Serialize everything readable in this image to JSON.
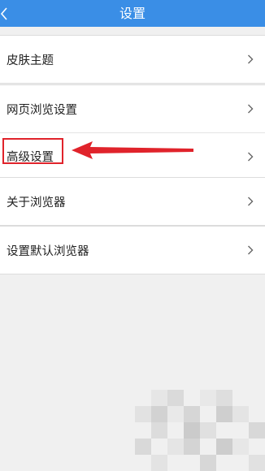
{
  "header": {
    "title": "设置",
    "back_icon": "chevron-left-icon"
  },
  "groups": [
    {
      "items": [
        {
          "label": "皮肤主题"
        }
      ]
    },
    {
      "items": [
        {
          "label": "网页浏览设置"
        },
        {
          "label": "高级设置"
        }
      ]
    },
    {
      "items": [
        {
          "label": "关于浏览器"
        }
      ]
    },
    {
      "items": [
        {
          "label": "设置默认浏览器"
        }
      ]
    }
  ],
  "annotation": {
    "color": "#e0232b",
    "target": "高级设置"
  },
  "colors": {
    "header": "#3a8ee6",
    "background": "#f0f0f0",
    "row": "#ffffff"
  }
}
